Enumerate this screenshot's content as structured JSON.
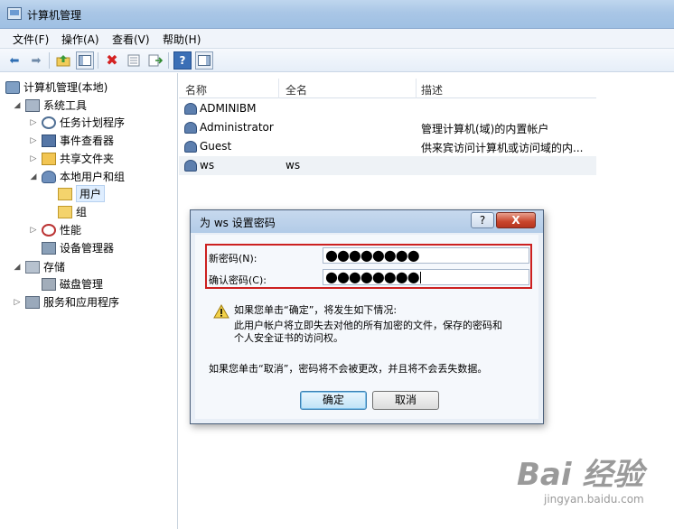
{
  "window": {
    "title": "计算机管理"
  },
  "menubar": {
    "items": [
      "文件(F)",
      "操作(A)",
      "查看(V)",
      "帮助(H)"
    ]
  },
  "toolbar": {
    "buttons": [
      "back-arrow-icon",
      "forward-arrow-icon",
      "up-folder-icon",
      "show-hide-tree-icon",
      "delete-icon",
      "properties-icon",
      "export-icon",
      "help-icon",
      "show-hide-action-icon"
    ]
  },
  "tree": {
    "root": "计算机管理(本地)",
    "system_tools": "系统工具",
    "task_scheduler": "任务计划程序",
    "event_viewer": "事件查看器",
    "shared_folders": "共享文件夹",
    "local_users_groups": "本地用户和组",
    "users": "用户",
    "groups": "组",
    "performance": "性能",
    "device_manager": "设备管理器",
    "storage": "存储",
    "disk_management": "磁盘管理",
    "services_apps": "服务和应用程序"
  },
  "list": {
    "columns": [
      "名称",
      "全名",
      "描述"
    ],
    "rows": [
      {
        "name": "ADMINIBM",
        "full_name": "",
        "description": ""
      },
      {
        "name": "Administrator",
        "full_name": "",
        "description": "管理计算机(域)的内置帐户"
      },
      {
        "name": "Guest",
        "full_name": "",
        "description": "供来宾访问计算机或访问域的内..."
      },
      {
        "name": "ws",
        "full_name": "ws",
        "description": ""
      }
    ]
  },
  "dialog": {
    "title": "为 ws 设置密码",
    "help_glyph": "?",
    "close_glyph": "X",
    "new_password_label": "新密码(N):",
    "new_password_value": "●●●●●●●●",
    "confirm_password_label": "确认密码(C):",
    "confirm_password_value": "●●●●●●●●",
    "warning_line1": "如果您单击“确定”，将发生如下情况:",
    "warning_line2": "此用户帐户将立即失去对他的所有加密的文件，保存的密码和",
    "warning_line3": "个人安全证书的访问权。",
    "cancel_note": "如果您单击“取消”，密码将不会被更改，并且将不会丢失数据。",
    "ok_label": "确定",
    "cancel_label": "取消"
  },
  "watermark": {
    "brand": "Bai 经验",
    "url": "jingyan.baidu.com"
  }
}
